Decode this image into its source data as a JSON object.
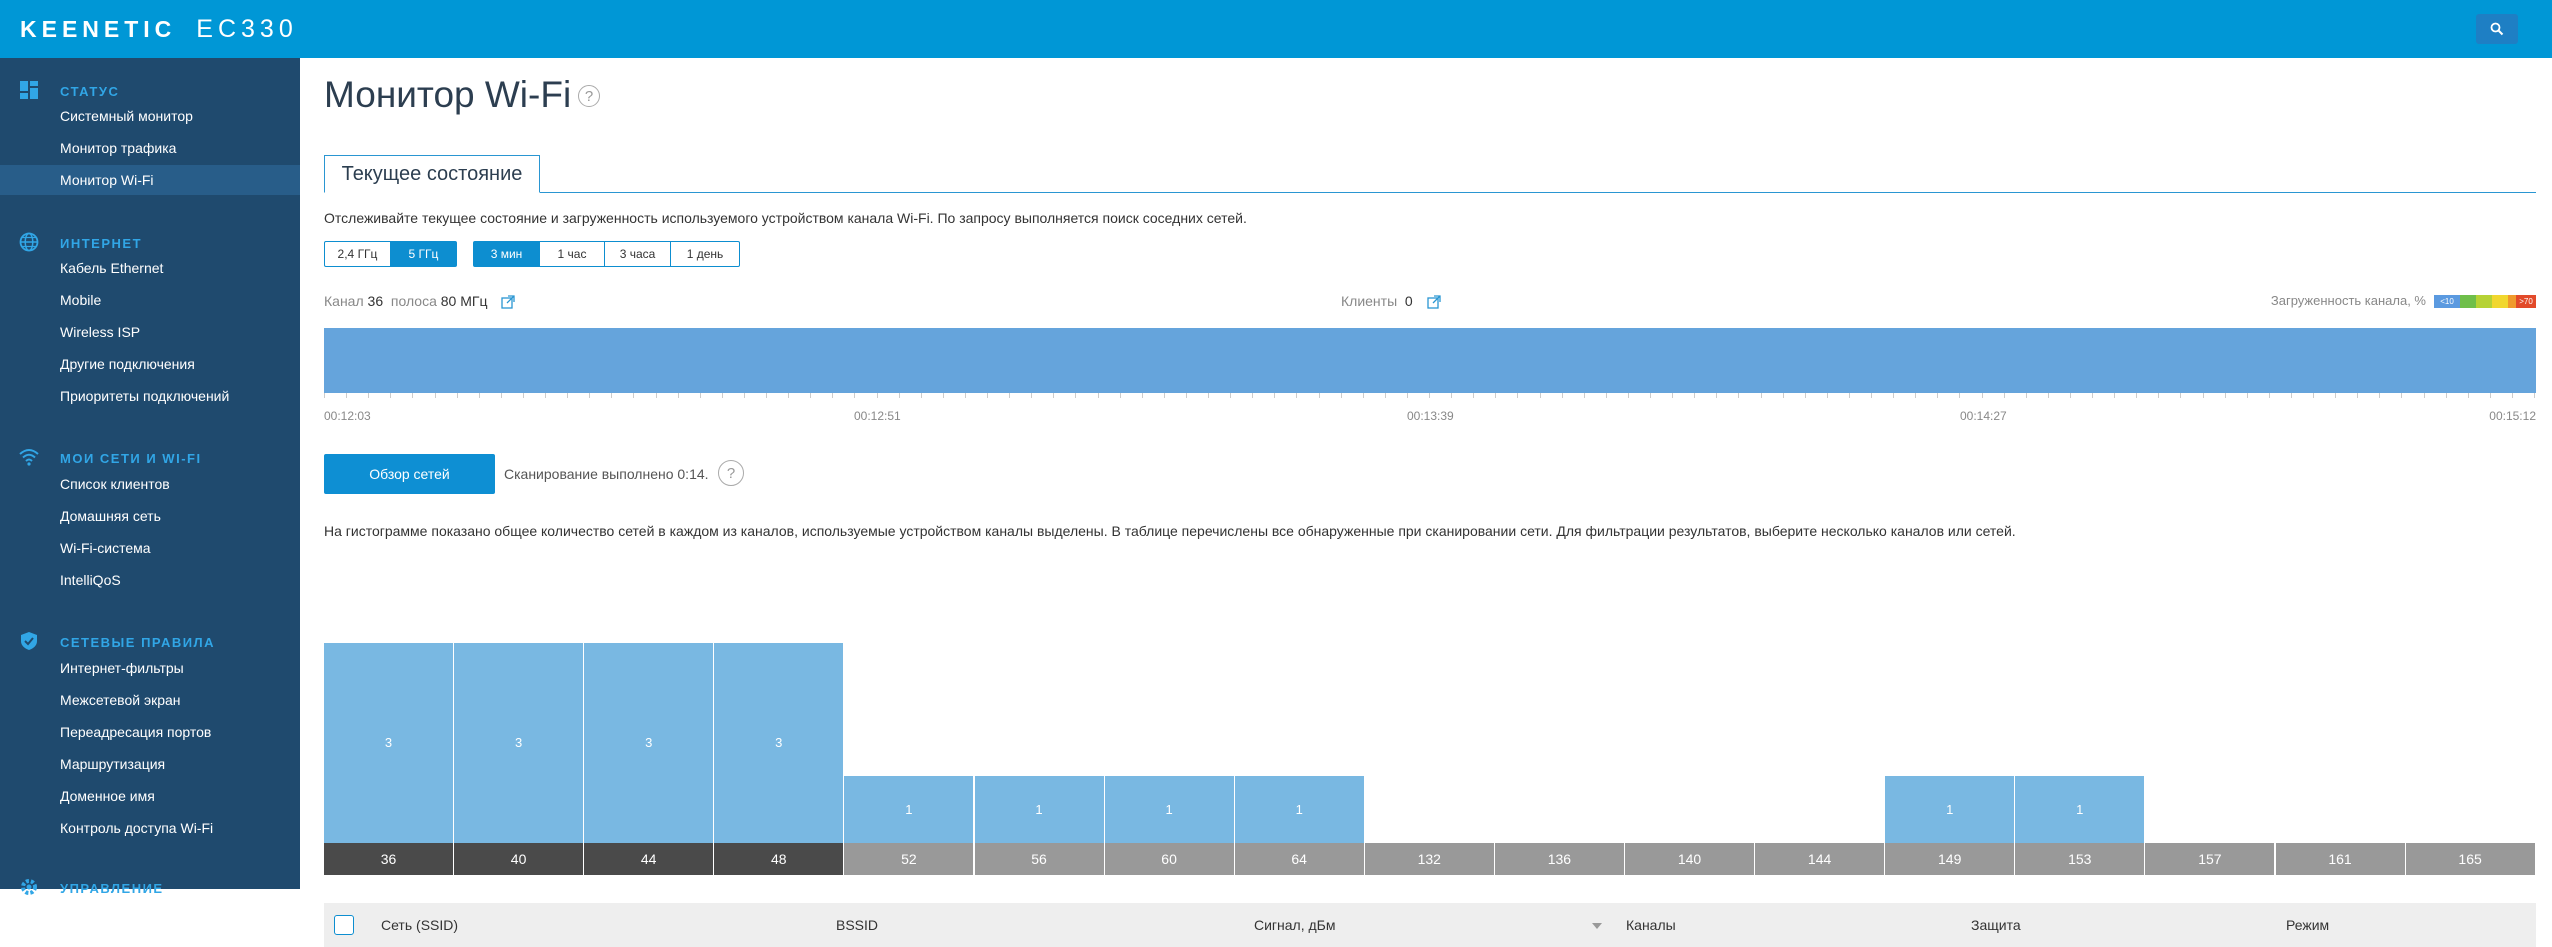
{
  "header": {
    "brand": "KEENETIC",
    "model": "EC330"
  },
  "sidebar": {
    "sections": [
      {
        "title": "Статус",
        "icon": "dashboard-icon",
        "items": [
          "Системный монитор",
          "Монитор трафика",
          "Монитор Wi-Fi"
        ]
      },
      {
        "title": "Интернет",
        "icon": "globe-icon",
        "items": [
          "Кабель Ethernet",
          "Mobile",
          "Wireless ISP",
          "Другие подключения",
          "Приоритеты подключений"
        ]
      },
      {
        "title": "Мои сети и Wi-Fi",
        "icon": "wifi-icon",
        "items": [
          "Список клиентов",
          "Домашняя сеть",
          "Wi-Fi-система",
          "IntelliQoS"
        ]
      },
      {
        "title": "Сетевые правила",
        "icon": "shield-icon",
        "items": [
          "Интернет-фильтры",
          "Межсетевой экран",
          "Переадресация портов",
          "Маршрутизация",
          "Доменное имя",
          "Контроль доступа Wi-Fi"
        ]
      },
      {
        "title": "Управление",
        "icon": "gear-icon",
        "items": []
      }
    ],
    "active_item": "Монитор Wi-Fi"
  },
  "main": {
    "title": "Монитор Wi-Fi",
    "help": "?",
    "tab": "Текущее состояние",
    "description": "Отслеживайте текущее состояние и загруженность используемого устройством канала Wi-Fi. По запросу выполняется поиск соседних сетей.",
    "bands": [
      {
        "label": "2,4 ГГц",
        "on": false
      },
      {
        "label": "5 ГГц",
        "on": true
      }
    ],
    "periods": [
      {
        "label": "3 мин",
        "on": true
      },
      {
        "label": "1 час",
        "on": false
      },
      {
        "label": "3 часа",
        "on": false
      },
      {
        "label": "1 день",
        "on": false
      }
    ],
    "channel_label": "Канал",
    "channel_value": "36",
    "width_label": "полоса",
    "width_value": "80 МГц",
    "clients_label": "Клиенты",
    "clients_value": "0",
    "load_label": "Загруженность канала, %",
    "load_legend": [
      {
        "text": "<10",
        "color": "#5b9ae0"
      },
      {
        "text": "",
        "color": "#6fbf4a"
      },
      {
        "text": "",
        "color": "#b6d235"
      },
      {
        "text": "",
        "color": "#f1d72e"
      },
      {
        "text": "",
        "color": "#f09a2c"
      },
      {
        "text": ">70",
        "color": "#e24a2a"
      }
    ],
    "channel_load_percent": 100,
    "times": [
      "00:12:03",
      "00:12:51",
      "00:13:39",
      "00:14:27",
      "00:15:12"
    ],
    "scan_button": "Обзор сетей",
    "scan_status": "Сканирование выполнено 0:14.",
    "histogram_description": "На гистограмме показано общее количество сетей в каждом из каналов, используемые устройством каналы выделены. В таблице перечислены все обнаруженные при сканировании сети. Для фильтрации результатов, выберите несколько каналов или сетей.",
    "table_headers": [
      "Сеть (SSID)",
      "BSSID",
      "Сигнал, дБм",
      "Каналы",
      "Защита",
      "Режим"
    ]
  },
  "chart_data": {
    "type": "bar",
    "categories": [
      "36",
      "40",
      "44",
      "48",
      "52",
      "56",
      "60",
      "64",
      "132",
      "136",
      "140",
      "144",
      "149",
      "153",
      "157",
      "161",
      "165"
    ],
    "values": [
      3,
      3,
      3,
      3,
      1,
      1,
      1,
      1,
      0,
      0,
      0,
      0,
      1,
      1,
      0,
      0,
      0
    ],
    "used_channels": [
      "36",
      "40",
      "44",
      "48"
    ]
  }
}
